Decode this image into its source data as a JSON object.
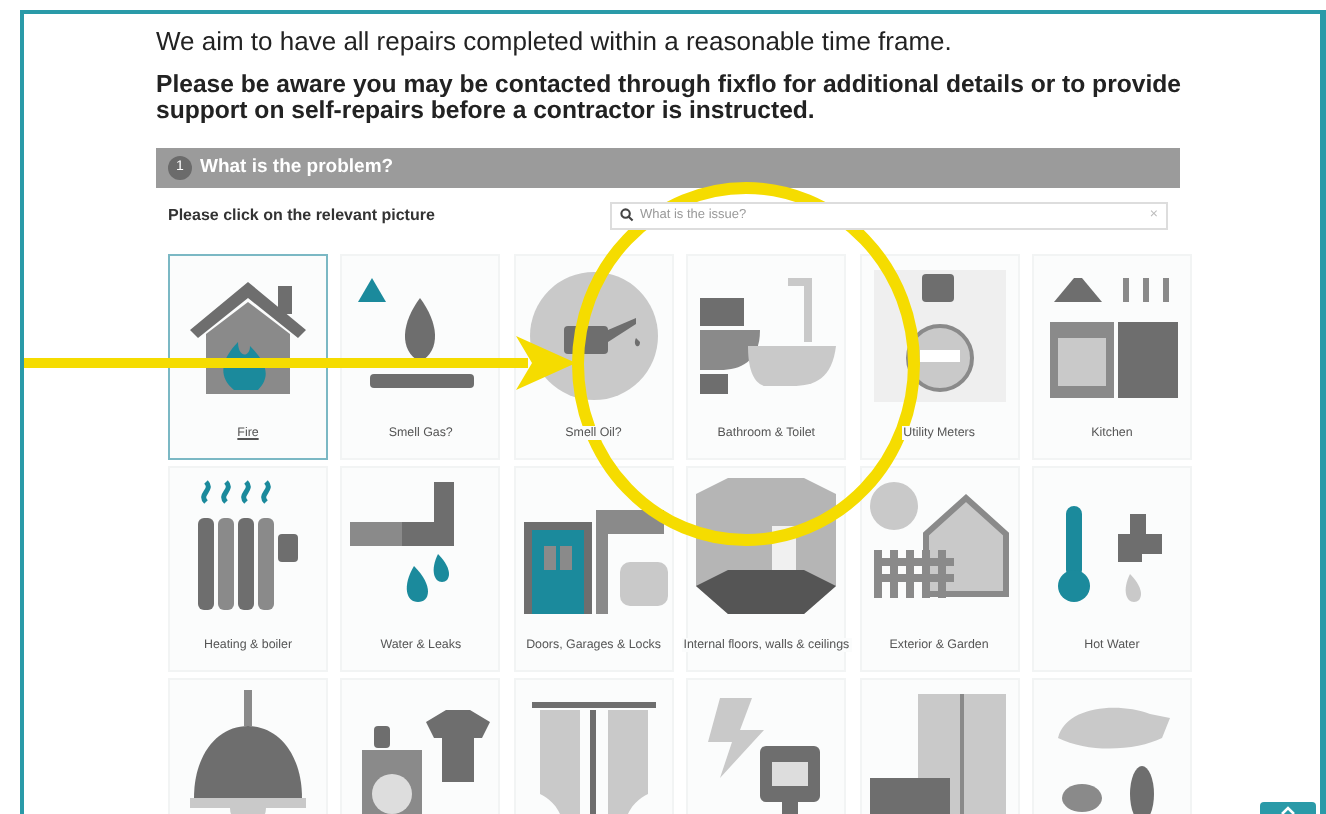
{
  "intro": "We aim to have all repairs completed within a reasonable time frame.",
  "notice": "Please be aware you may be contacted through fixflo for additional details or to provide support on self-repairs before a contractor is instructed.",
  "section": {
    "number": "1",
    "title": "What is the problem?"
  },
  "instruction": "Please click on the relevant picture",
  "search": {
    "placeholder": "What is the issue?",
    "clear": "×"
  },
  "tiles": [
    {
      "label": "Fire",
      "selected": true
    },
    {
      "label": "Smell Gas?",
      "selected": false
    },
    {
      "label": "Smell Oil?",
      "selected": false
    },
    {
      "label": "Bathroom & Toilet",
      "selected": false
    },
    {
      "label": "Utility Meters",
      "selected": false
    },
    {
      "label": "Kitchen",
      "selected": false
    },
    {
      "label": "Heating & boiler",
      "selected": false
    },
    {
      "label": "Water & Leaks",
      "selected": false
    },
    {
      "label": "Doors, Garages & Locks",
      "selected": false
    },
    {
      "label": "Internal floors, walls & ceilings",
      "selected": false
    },
    {
      "label": "Exterior & Garden",
      "selected": false
    },
    {
      "label": "Hot Water",
      "selected": false
    },
    {
      "selected": false
    },
    {
      "selected": false
    },
    {
      "selected": false
    },
    {
      "selected": false
    },
    {
      "selected": false
    },
    {
      "selected": false
    }
  ]
}
